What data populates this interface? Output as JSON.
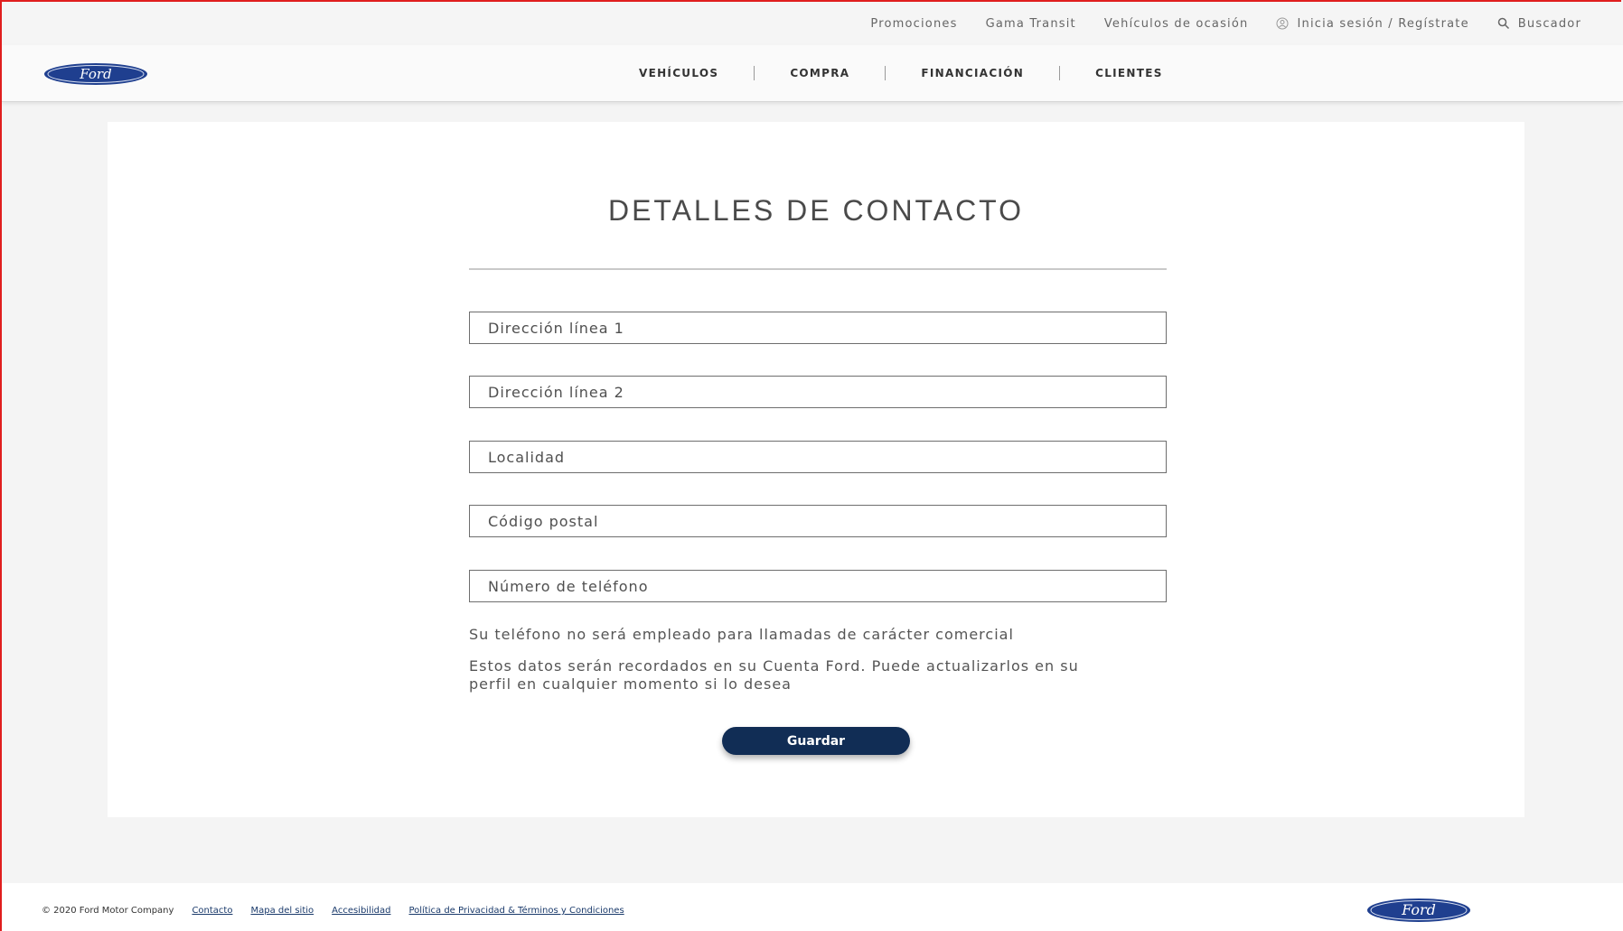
{
  "utility_bar": {
    "items": [
      "Promociones",
      "Gama Transit",
      "Vehículos de ocasión"
    ],
    "login": "Inicia sesión / Regístrate",
    "search": "Buscador",
    "login_icon": "user-icon",
    "search_icon": "magnifier-icon"
  },
  "brand": {
    "logo_text": "Ford",
    "logo_color": "#1f3f8f"
  },
  "main_nav": {
    "items": [
      "VEHÍCULOS",
      "COMPRA",
      "FINANCIACIÓN",
      "CLIENTES"
    ]
  },
  "form": {
    "title": "DETALLES DE CONTACTO",
    "fields": {
      "address1": "Dirección línea 1",
      "address2": "Dirección línea 2",
      "city": "Localidad",
      "postal": "Código postal",
      "phone": "Número de teléfono"
    },
    "phone_note": "Su teléfono no será empleado para llamadas de carácter comercial",
    "account_note": "Estos datos serán recordados en su Cuenta Ford. Puede actualizarlos en su perfil en cualquier momento si lo desea",
    "save_label": "Guardar",
    "accent_color": "#112d55"
  },
  "footer": {
    "copyright": "© 2020 Ford Motor Company",
    "links": [
      "Contacto",
      "Mapa del sitio",
      "Accesibilidad",
      "Política de Privacidad & Términos y Condiciones"
    ]
  }
}
